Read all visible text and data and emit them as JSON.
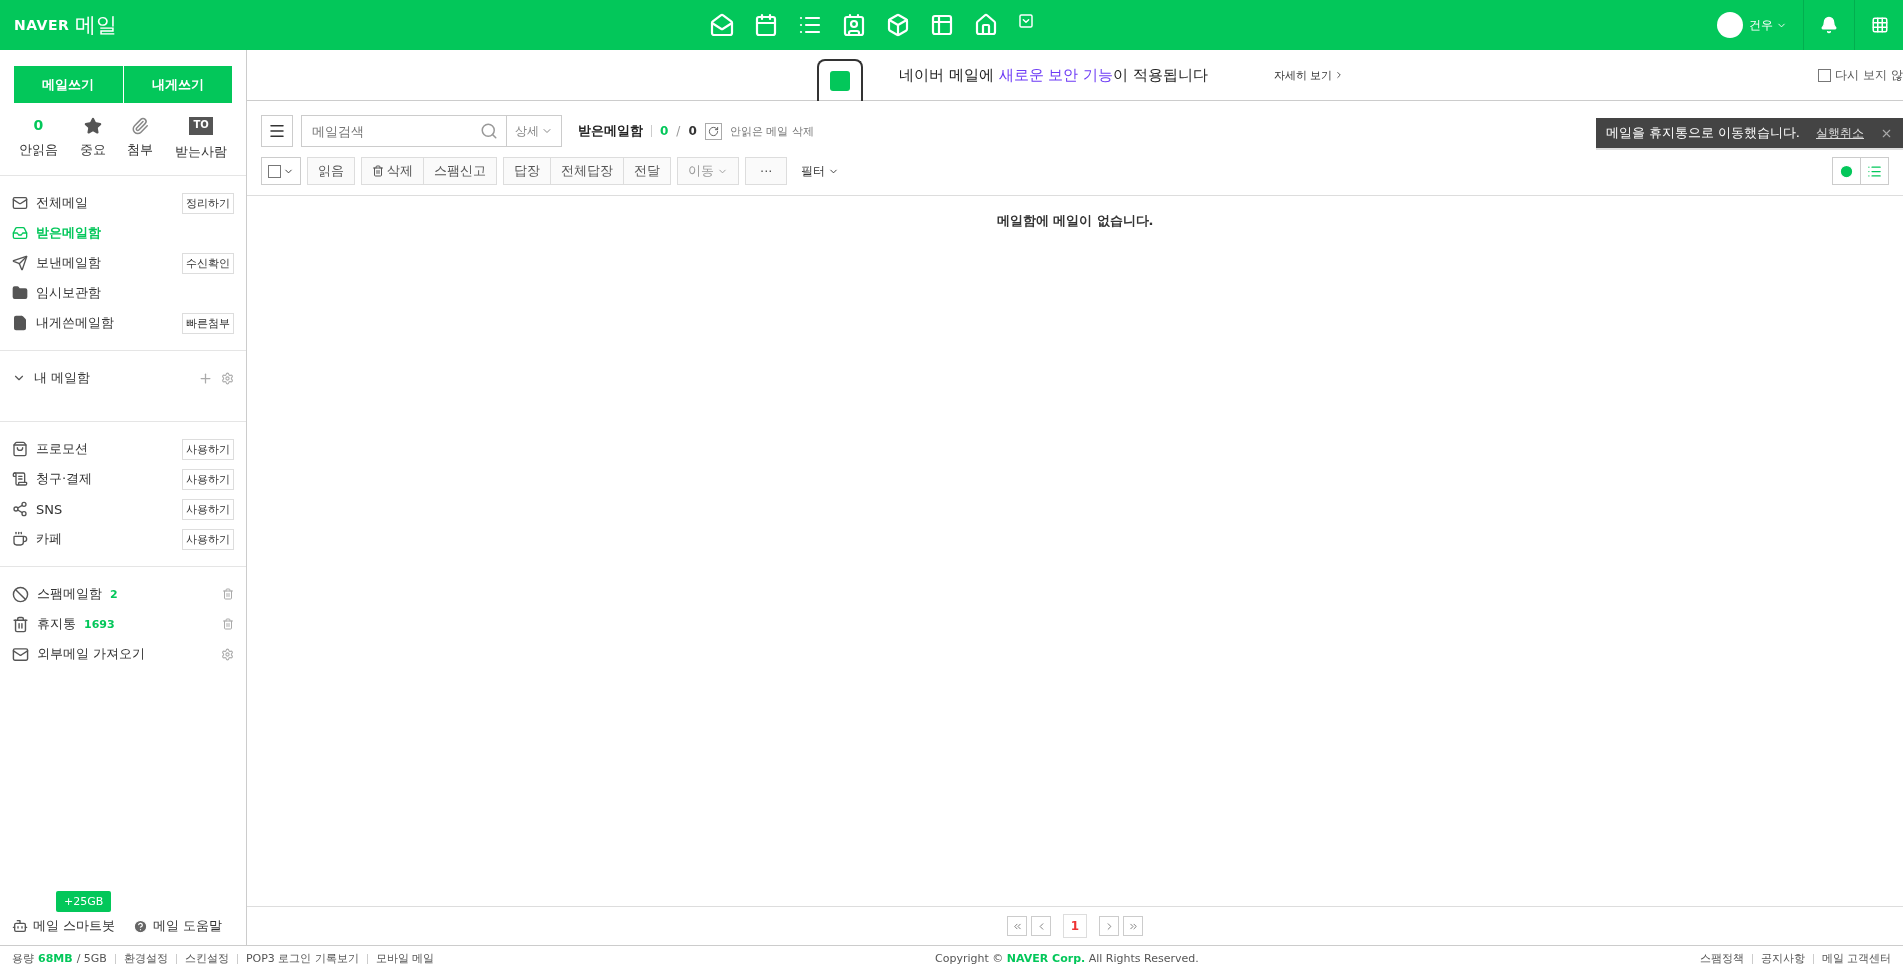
{
  "header": {
    "logo": "NAVER",
    "title": "메일",
    "user": {
      "name": "건우"
    }
  },
  "sidebar": {
    "compose_buttons": [
      "메일쓰기",
      "내게쓰기"
    ],
    "quick_filters": [
      {
        "kind": "count",
        "value": "0",
        "label": "안읽음"
      },
      {
        "kind": "star",
        "label": "중요"
      },
      {
        "kind": "clip",
        "label": "첨부"
      },
      {
        "kind": "to",
        "value": "TO",
        "label": "받는사람"
      }
    ],
    "folders": [
      {
        "kind": "all",
        "label": "전체메일",
        "action": "정리하기",
        "selected": false
      },
      {
        "kind": "inbox",
        "label": "받은메일함",
        "selected": true
      },
      {
        "kind": "sent",
        "label": "보낸메일함",
        "action": "수신확인",
        "selected": false
      },
      {
        "kind": "draft",
        "label": "임시보관함",
        "selected": false
      },
      {
        "kind": "self",
        "label": "내게쓴메일함",
        "action": "빠른첨부",
        "selected": false
      }
    ],
    "my_mailbox": {
      "label": "내 메일함",
      "expanded": true
    },
    "services": [
      {
        "kind": "bag",
        "label": "프로모션",
        "action": "사용하기"
      },
      {
        "kind": "bill",
        "label": "청구·결제",
        "action": "사용하기"
      },
      {
        "kind": "share",
        "label": "SNS",
        "action": "사용하기"
      },
      {
        "kind": "cafe",
        "label": "카페",
        "action": "사용하기"
      }
    ],
    "special": [
      {
        "kind": "spam",
        "label": "스팸메일함",
        "count": "2"
      },
      {
        "kind": "trash",
        "label": "휴지통",
        "count": "1693"
      },
      {
        "kind": "external",
        "label": "외부메일 가져오기"
      }
    ],
    "bottom_links": [
      {
        "kind": "bot",
        "label": "메일 스마트봇"
      },
      {
        "kind": "help",
        "label": "메일 도움말"
      }
    ],
    "storage_badge": "+25GB"
  },
  "banner": {
    "text": "네이버 메일에 **새로운 보안 기능**이 적용됩니다",
    "link": "자세히 보기",
    "dismiss": {
      "label": "다시 보지 않",
      "checked": false
    }
  },
  "toolbar": {
    "search_placeholder": "메일검색",
    "detail": "상세",
    "mailbox": "받은메일함",
    "unread": "0",
    "count_separator": "/",
    "total": "0",
    "select_all_checked": false,
    "delete_unread": "안읽은 메일 삭제",
    "actions": [
      {
        "kind": "plain",
        "label": "읽음"
      },
      {
        "kind": "group_start",
        "label": "삭제"
      },
      {
        "kind": "group_end",
        "label": "스팸신고"
      },
      {
        "kind": "group_start",
        "label": "답장"
      },
      {
        "kind": "group_mid",
        "label": "전체답장"
      },
      {
        "kind": "group_end",
        "label": "전달"
      },
      {
        "kind": "dropdown",
        "label": "이동"
      },
      {
        "kind": "more",
        "label": "···"
      }
    ],
    "filter": "필터"
  },
  "toast": {
    "text": "메일을 휴지통으로 이동했습니다.",
    "undo": "실행취소"
  },
  "empty_message": "메일함에 메일이 없습니다.",
  "pagination": {
    "pages": [
      {
        "label": "1",
        "selected": true
      }
    ]
  },
  "footer": {
    "storage_label": "용량",
    "storage_used": "68MB",
    "storage_total": "/ 5GB",
    "links": [
      "환경설정",
      "스킨설정",
      "POP3 로그인 기록보기",
      "모바일 메일"
    ],
    "copyright": "Copyright © **NAVER Corp.** All Rights Reserved.",
    "right_links": [
      "스팸정책",
      "공지사항",
      "메일 고객센터"
    ]
  }
}
